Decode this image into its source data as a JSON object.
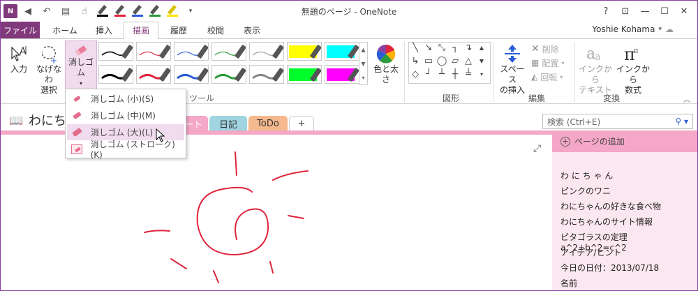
{
  "window": {
    "title": "無題のページ - OneNote",
    "controls": [
      "?",
      "⊡",
      "—",
      "☐",
      "✕"
    ]
  },
  "qat": {
    "logo": "N"
  },
  "tabs": {
    "file": "ファイル",
    "items": [
      "ホーム",
      "挿入",
      "描画",
      "履歴",
      "校閲",
      "表示"
    ],
    "active": "描画"
  },
  "user": {
    "name": "Yoshie Kohama"
  },
  "ribbon": {
    "tools": {
      "input_label": "入力",
      "lasso_label": "なげなわ\n選択",
      "eraser_label": "消しゴム",
      "group_label": "ツール"
    },
    "color_thickness_label": "色と太さ",
    "shapes_label": "図形",
    "edit": {
      "insert_space_label": "スペース\nの挿入",
      "delete_label": "削除",
      "arrange_label": "配置",
      "rotate_label": "回転",
      "group_label": "編集"
    },
    "convert": {
      "ink_to_text_label": "インクから\nテキスト",
      "ink_to_math_label": "インクから\n数式",
      "group_label": "変換"
    }
  },
  "eraser_menu": {
    "items": [
      "消しゴム (小)(S)",
      "消しゴム (中)(M)",
      "消しゴム (大)(L)",
      "消しゴム (ストローク)(K)"
    ],
    "hovered": 2
  },
  "notebook": {
    "title": "わにち",
    "section_tabs": [
      "ート",
      "日記",
      "ToDo",
      "+"
    ]
  },
  "search": {
    "placeholder": "検索 (Ctrl+E)"
  },
  "pages": {
    "add_label": "ページの追加",
    "items": [
      "わ に ち ゃ ん",
      "ピンクのワニ",
      "わにちゃんの好きな食べ物",
      "わにちゃんのサイト情報",
      "ピタゴラスの定理　a^2+b^2=c^2",
      "アイデア/ヒント",
      "今日の日付：2013/07/18",
      "名前"
    ]
  },
  "colors": {
    "accent": "#80397b",
    "pink": "#f4a7c6",
    "ink_red": "#e0243c"
  }
}
